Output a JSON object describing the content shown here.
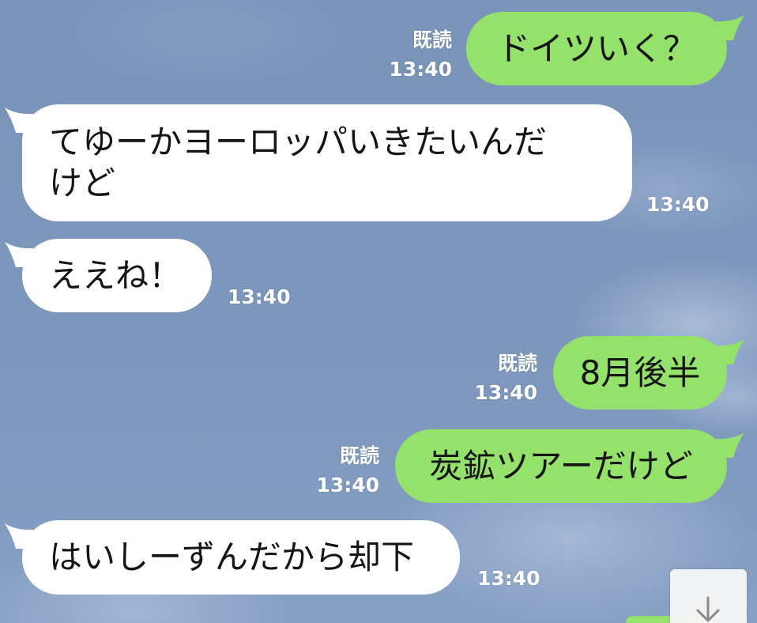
{
  "colors": {
    "background": "#7c96bc",
    "outgoing_bubble": "#94e16b",
    "incoming_bubble": "#ffffff",
    "meta_text": "#ffffff"
  },
  "messages": [
    {
      "direction": "out",
      "text": "ドイツいく？",
      "read": "既読",
      "time": "13:40"
    },
    {
      "direction": "in",
      "text": "てゆーかヨーロッパいきたいんだ\nけど",
      "time": "13:40"
    },
    {
      "direction": "in",
      "text": "ええね！",
      "time": "13:40"
    },
    {
      "direction": "out",
      "text": "8月後半",
      "read": "既読",
      "time": "13:40"
    },
    {
      "direction": "out",
      "text": "炭鉱ツアーだけど",
      "read": "既読",
      "time": "13:40"
    },
    {
      "direction": "in",
      "text": "はいしーずんだから却下",
      "time": "13:40"
    }
  ],
  "partial_message": {
    "direction": "out"
  },
  "scroll_button": {
    "icon": "arrow-down-icon"
  }
}
